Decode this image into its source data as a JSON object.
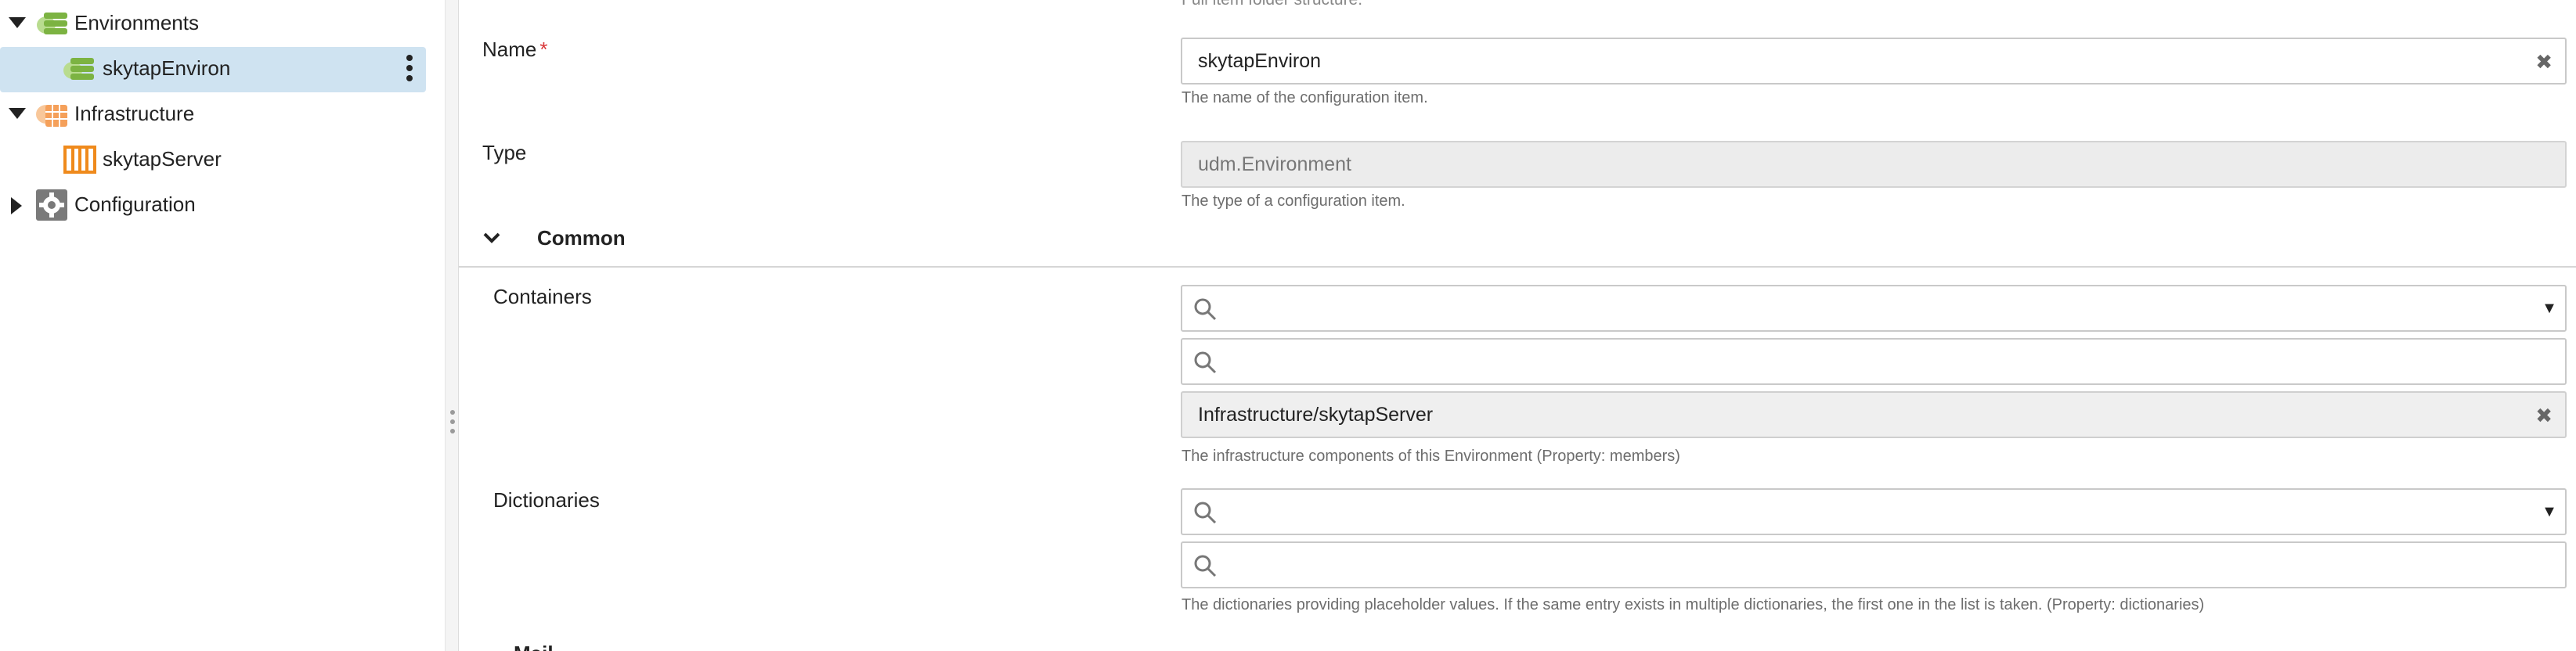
{
  "tree": {
    "items": [
      {
        "label": "Environments",
        "expanded": true,
        "icon": "environments-icon"
      },
      {
        "label": "skytapEnviron",
        "selected": true,
        "icon": "environment-icon"
      },
      {
        "label": "Infrastructure",
        "expanded": true,
        "icon": "infrastructure-icon"
      },
      {
        "label": "skytapServer",
        "icon": "server-icon"
      },
      {
        "label": "Configuration",
        "expanded": false,
        "icon": "gear-icon"
      }
    ]
  },
  "form": {
    "top_cut_text": "Full item folder structure.",
    "name": {
      "label": "Name",
      "required_mark": "*",
      "value": "skytapEnviron",
      "hint": "The name of the configuration item."
    },
    "type": {
      "label": "Type",
      "value": "udm.Environment",
      "hint": "The type of a configuration item."
    },
    "section_common": "Common",
    "containers": {
      "label": "Containers",
      "selected_item": "Infrastructure/skytapServer",
      "hint": "The infrastructure components of this Environment (Property: members)"
    },
    "dictionaries": {
      "label": "Dictionaries",
      "hint": "The dictionaries providing placeholder values. If the same entry exists in multiple dictionaries, the first one in the list is taken. (Property: dictionaries)"
    },
    "bottom_cut_text": "Mail"
  },
  "colors": {
    "selected_row": "#cfe3f1",
    "env_icon": "#7cb342",
    "infra_icon": "#f5a05a",
    "server_icon": "#ef8a1c",
    "gear_icon": "#7a7a7a",
    "required": "#d9383a"
  }
}
